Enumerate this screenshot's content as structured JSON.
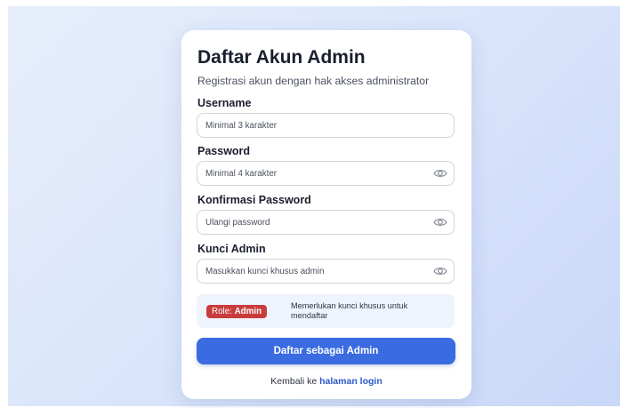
{
  "form": {
    "title": "Daftar Akun Admin",
    "subtitle": "Registrasi akun dengan hak akses administrator",
    "username": {
      "label": "Username",
      "placeholder": "Minimal 3 karakter",
      "value": ""
    },
    "password": {
      "label": "Password",
      "placeholder": "Minimal 4 karakter",
      "value": "",
      "toggle_icon": "eye-icon"
    },
    "confirm_password": {
      "label": "Konfirmasi Password",
      "placeholder": "Ulangi password",
      "value": "",
      "toggle_icon": "eye-icon"
    },
    "admin_key": {
      "label": "Kunci Admin",
      "placeholder": "Masukkan kunci khusus admin",
      "value": "",
      "toggle_icon": "eye-icon"
    },
    "role_info": {
      "badge_prefix": "Role:",
      "badge_role": "Admin",
      "note": "Memerlukan kunci khusus untuk mendaftar",
      "badge_color": "#c93c3c"
    },
    "submit_label": "Daftar sebagai Admin",
    "footer": {
      "prefix": "Kembali ke",
      "link_label": "halaman login"
    }
  },
  "colors": {
    "accent": "#3a6be0",
    "link": "#2a57c8",
    "info_bg": "#eff3fb"
  }
}
